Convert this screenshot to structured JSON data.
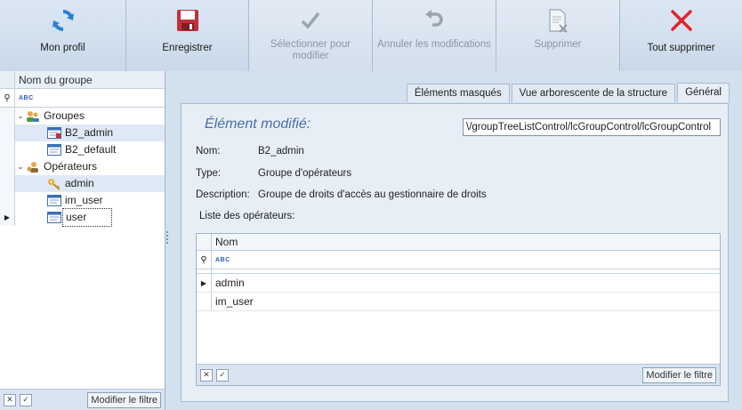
{
  "toolbar": {
    "buttons": [
      {
        "label": "Mon profil",
        "icon": "refresh-icon",
        "enabled": true
      },
      {
        "label": "Enregistrer",
        "icon": "save-icon",
        "enabled": true
      },
      {
        "label": "Sélectionner pour modifier",
        "icon": "checkmark-icon",
        "enabled": false
      },
      {
        "label": "Annuler les modifications",
        "icon": "undo-icon",
        "enabled": false
      },
      {
        "label": "Supprimer",
        "icon": "delete-document-icon",
        "enabled": false
      },
      {
        "label": "Tout supprimer",
        "icon": "red-x-icon",
        "enabled": true
      }
    ]
  },
  "left_panel": {
    "column_header": "Nom du groupe",
    "filter_placeholder": "ABC",
    "tree": [
      {
        "label": "Groupes",
        "level": 0,
        "expanded": true,
        "icon": "group-users-icon"
      },
      {
        "label": "B2_admin",
        "level": 1,
        "icon": "group-item-icon",
        "highlighted": true
      },
      {
        "label": "B2_default",
        "level": 1,
        "icon": "group-item-icon"
      },
      {
        "label": "Opérateurs",
        "level": 0,
        "expanded": true,
        "icon": "operators-icon"
      },
      {
        "label": "admin",
        "level": 1,
        "icon": "key-icon",
        "highlighted": true
      },
      {
        "label": "im_user",
        "level": 1,
        "icon": "user-card-icon"
      },
      {
        "label": "user",
        "level": 1,
        "icon": "user-card-icon",
        "current": true
      }
    ],
    "footer_button": "Modifier le filtre"
  },
  "tabs": [
    {
      "label": "Éléments masqués",
      "active": false
    },
    {
      "label": "Vue arborescente de la structure",
      "active": false
    },
    {
      "label": "Général",
      "active": true
    }
  ],
  "detail": {
    "title": "Élément modifié:",
    "path_value": "\\/groupTreeListControl/lcGroupControl/lcGroupControl",
    "name_label": "Nom:",
    "name_value": "B2_admin",
    "type_label": "Type:",
    "type_value": "Groupe d'opérateurs",
    "desc_label": "Description:",
    "desc_value": "Groupe de droits d'accès au gestionnaire de droits",
    "operators_label": "Liste des opérateurs:",
    "grid": {
      "column_header": "Nom",
      "filter_placeholder": "ABC",
      "rows": [
        "admin",
        "im_user"
      ],
      "footer_button": "Modifier le filtre"
    }
  },
  "colors": {
    "toolbar_bg": "#d3e0ee",
    "title_blue": "#4a6ea8",
    "delete_red": "#e0262a"
  }
}
